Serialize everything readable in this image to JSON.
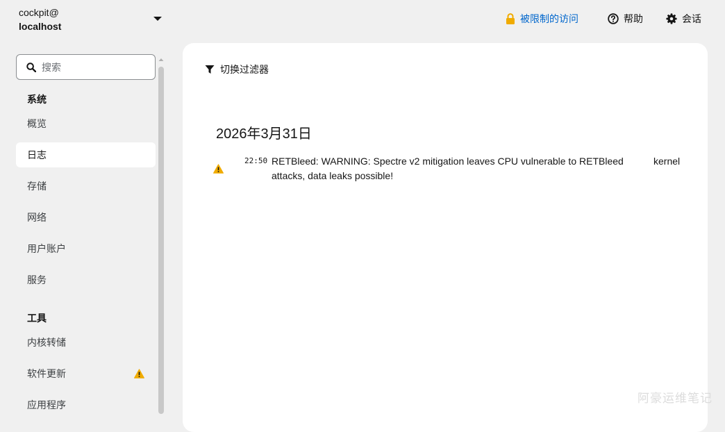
{
  "host": {
    "user": "cockpit@",
    "name": "localhost"
  },
  "topbar": {
    "limited_access": "被限制的访问",
    "help": "帮助",
    "session": "会话"
  },
  "sidebar": {
    "search_placeholder": "搜索",
    "group_system": "系统",
    "group_tools": "工具",
    "items": [
      {
        "label": "概览"
      },
      {
        "label": "日志"
      },
      {
        "label": "存储"
      },
      {
        "label": "网络"
      },
      {
        "label": "用户账户"
      },
      {
        "label": "服务"
      },
      {
        "label": "内核转储"
      },
      {
        "label": "软件更新"
      },
      {
        "label": "应用程序"
      }
    ]
  },
  "main": {
    "filter_toggle": "切换过滤器",
    "date_heading": "2026年3月31日",
    "entries": [
      {
        "time": "22:50",
        "message": "RETBleed: WARNING: Spectre v2 mitigation leaves CPU vulnerable to RETBleed attacks, data leaks possible!",
        "source": "kernel",
        "severity": "warning"
      }
    ]
  },
  "colors": {
    "accent": "#0066cc",
    "warning": "#f0ab00",
    "page_bg": "#f0f0f0",
    "card_bg": "#ffffff"
  },
  "watermark": "阿豪运维笔记"
}
